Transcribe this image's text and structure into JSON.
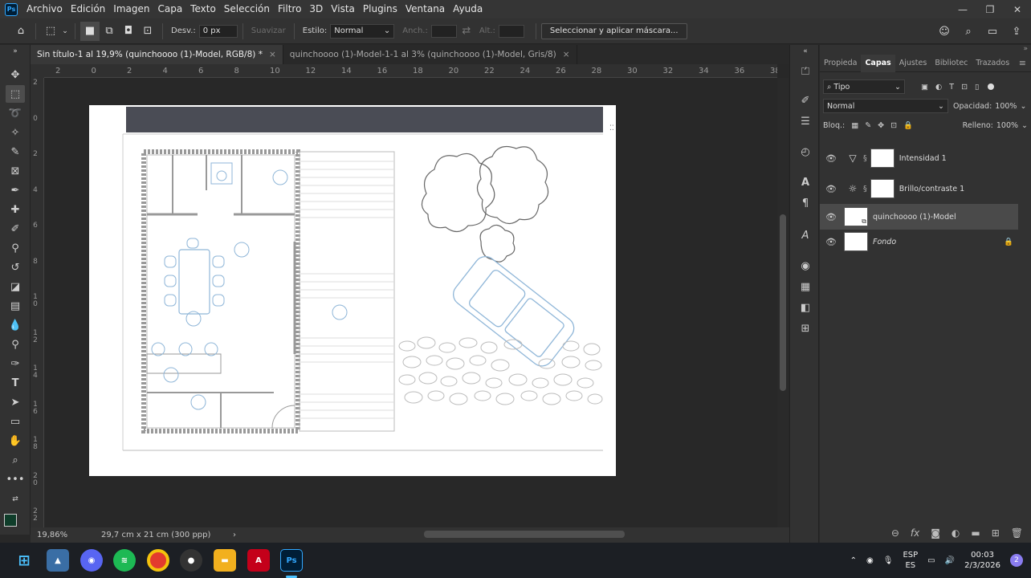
{
  "menubar": {
    "logo": "Ps",
    "items": [
      "Archivo",
      "Edición",
      "Imagen",
      "Capa",
      "Texto",
      "Selección",
      "Filtro",
      "3D",
      "Vista",
      "Plugins",
      "Ventana",
      "Ayuda"
    ],
    "controls": [
      "—",
      "❐",
      "✕"
    ]
  },
  "options": {
    "desv_label": "Desv.:",
    "desv_value": "0 px",
    "suavizar_label": "Suavizar",
    "estilo_label": "Estilo:",
    "estilo_value": "Normal",
    "anch_label": "Anch.:",
    "alt_label": "Alt.:",
    "mask_button": "Seleccionar y aplicar máscara..."
  },
  "tabs": [
    {
      "label": "Sin título-1 al 19,9% (quinchoooo (1)-Model, RGB/8) *",
      "close": "×"
    },
    {
      "label": "quinchoooo (1)-Model-1-1 al 3% (quinchoooo (1)-Model, Gris/8)",
      "close": "×"
    }
  ],
  "ruler_h": [
    "2",
    "0",
    "2",
    "4",
    "6",
    "8",
    "10",
    "12",
    "14",
    "16",
    "18",
    "20",
    "22",
    "24",
    "26",
    "28",
    "30",
    "32",
    "34",
    "36",
    "38"
  ],
  "ruler_v": [
    "2",
    "0",
    "2",
    "4",
    "6",
    "8",
    "10",
    "12",
    "14",
    "16",
    "18",
    "20",
    "22"
  ],
  "status": {
    "zoom": "19,86%",
    "doc_size": "29,7 cm x 21 cm (300 ppp)",
    "arrow": "›"
  },
  "layers_panel": {
    "tabs": [
      "Propieda",
      "Capas",
      "Ajustes",
      "Bibliotec",
      "Trazados"
    ],
    "filter": "Tipo",
    "blend_mode": "Normal",
    "opacity_label": "Opacidad:",
    "opacity_value": "100%",
    "lock_label": "Bloq.:",
    "fill_label": "Relleno:",
    "fill_value": "100%",
    "layers": [
      {
        "name": "Intensidad 1",
        "icon": "▽"
      },
      {
        "name": "Brillo/contraste 1",
        "icon": "☼"
      },
      {
        "name": "quinchoooo (1)-Model",
        "icon": ""
      },
      {
        "name": "Fondo",
        "icon": ""
      }
    ]
  },
  "taskbar": {
    "lang_top": "ESP",
    "lang_bottom": "ES",
    "time": "00:03",
    "date": "2/3/2026",
    "notif_count": "2",
    "ps_label": "Ps"
  },
  "colors": {
    "accent": "#31a8ff",
    "bg": "#282828",
    "panel": "#323232",
    "drawing_line": "#8fb6d8"
  }
}
